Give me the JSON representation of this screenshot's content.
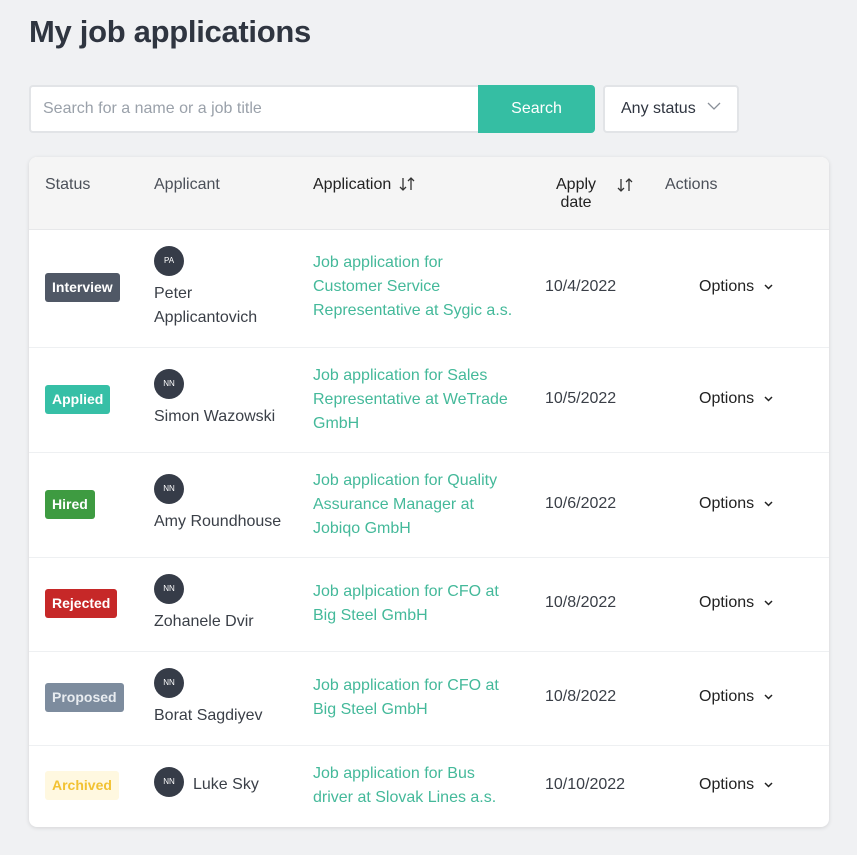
{
  "page": {
    "title": "My job applications"
  },
  "search": {
    "placeholder": "Search for a name or a job title",
    "value": "",
    "button_label": "Search"
  },
  "status_filter": {
    "selected": "Any status"
  },
  "table": {
    "headers": {
      "status": "Status",
      "applicant": "Applicant",
      "application": "Application",
      "apply_date_line1": "Apply",
      "apply_date_line2": "date",
      "actions": "Actions"
    },
    "rows": [
      {
        "status": "Interview",
        "status_color": "#505866",
        "status_text_color": "#ffffff",
        "initials": "PA",
        "name_line1": "Peter",
        "name_line2": "Applicantovich",
        "app_line1": "Job application for",
        "app_line2": "Customer Service",
        "app_line3": "Representative at Sygic a.s.",
        "date": "10/4/2022",
        "actions": "Options"
      },
      {
        "status": "Applied",
        "status_color": "#36bfa6",
        "status_text_color": "#ffffff",
        "initials": "NN",
        "name_line1": "Simon Wazowski",
        "app_line1": "Job application for Sales",
        "app_line2": "Representative at WeTrade",
        "app_line3": "GmbH",
        "date": "10/5/2022",
        "actions": "Options"
      },
      {
        "status": "Hired",
        "status_color": "#3e9b41",
        "status_text_color": "#ffffff",
        "initials": "NN",
        "name_line1": "Amy Roundhouse",
        "app_line1": "Job application for Quality",
        "app_line2": "Assurance Manager at",
        "app_line3": "Jobiqo GmbH",
        "date": "10/6/2022",
        "actions": "Options"
      },
      {
        "status": "Rejected",
        "status_color": "#c62828",
        "status_text_color": "#ffffff",
        "initials": "NN",
        "name_line1": "Zohanele Dvir",
        "app_line1": "Job aplpication for CFO at",
        "app_line2": "Big Steel GmbH",
        "date": "10/8/2022",
        "actions": "Options"
      },
      {
        "status": "Proposed",
        "status_color": "#7d8c9e",
        "status_text_color": "#e8ecf0",
        "initials": "NN",
        "name_line1": "Borat Sagdiyev",
        "app_line1": "Job application for CFO at",
        "app_line2": "Big Steel GmbH",
        "date": "10/8/2022",
        "actions": "Options"
      },
      {
        "status": "Archived",
        "status_color": "#fff8e0",
        "status_text_color": "#f2c233",
        "initials": "NN",
        "name_line1": "Luke Sky",
        "app_line1": "Job application for Bus",
        "app_line2": "driver at Slovak Lines a.s.",
        "date": "10/10/2022",
        "actions": "Options"
      }
    ]
  },
  "colors": {
    "accent": "#35bea3",
    "link": "#44b99a"
  }
}
